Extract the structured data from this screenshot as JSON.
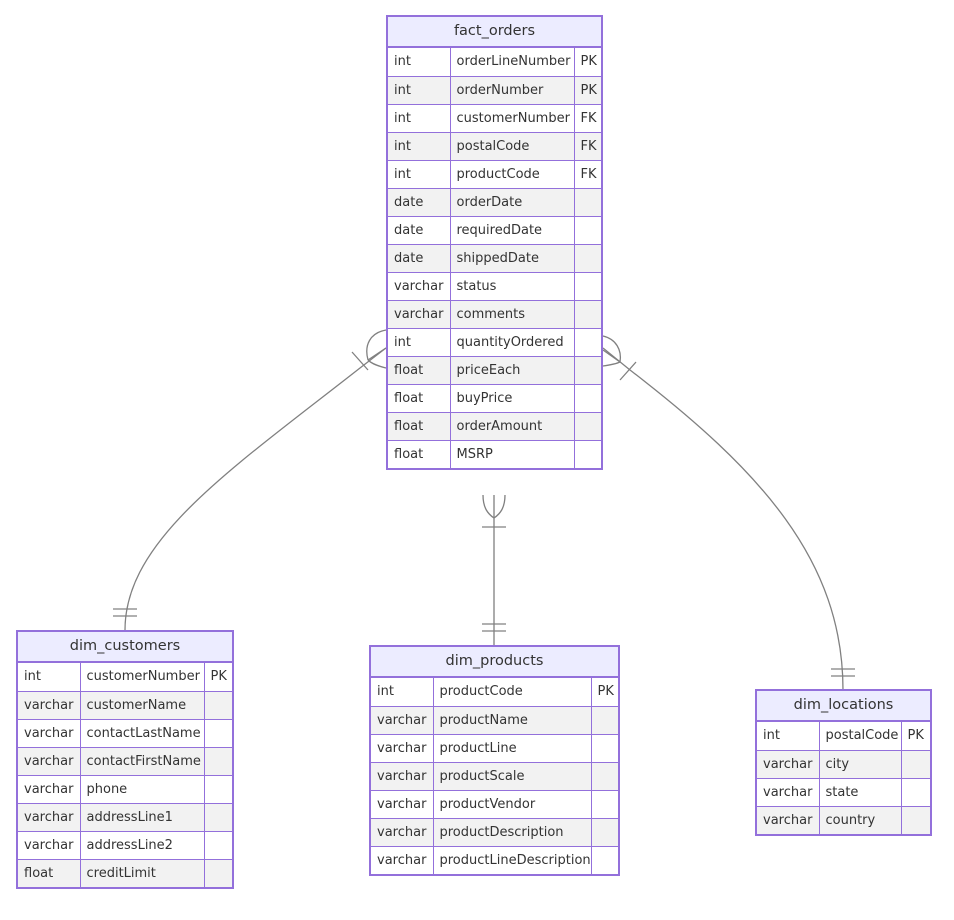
{
  "diagram": {
    "type": "entity-relationship",
    "colors": {
      "border": "#9370db",
      "header_bg": "#ececff",
      "row_alt": "#f2f2f2",
      "edge": "#808080"
    },
    "entities": [
      {
        "id": "fact_orders",
        "name": "fact_orders",
        "attributes": [
          {
            "type": "int",
            "name": "orderLineNumber",
            "key": "PK"
          },
          {
            "type": "int",
            "name": "orderNumber",
            "key": "PK"
          },
          {
            "type": "int",
            "name": "customerNumber",
            "key": "FK"
          },
          {
            "type": "int",
            "name": "postalCode",
            "key": "FK"
          },
          {
            "type": "int",
            "name": "productCode",
            "key": "FK"
          },
          {
            "type": "date",
            "name": "orderDate",
            "key": ""
          },
          {
            "type": "date",
            "name": "requiredDate",
            "key": ""
          },
          {
            "type": "date",
            "name": "shippedDate",
            "key": ""
          },
          {
            "type": "varchar",
            "name": "status",
            "key": ""
          },
          {
            "type": "varchar",
            "name": "comments",
            "key": ""
          },
          {
            "type": "int",
            "name": "quantityOrdered",
            "key": ""
          },
          {
            "type": "float",
            "name": "priceEach",
            "key": ""
          },
          {
            "type": "float",
            "name": "buyPrice",
            "key": ""
          },
          {
            "type": "float",
            "name": "orderAmount",
            "key": ""
          },
          {
            "type": "float",
            "name": "MSRP",
            "key": ""
          }
        ]
      },
      {
        "id": "dim_customers",
        "name": "dim_customers",
        "attributes": [
          {
            "type": "int",
            "name": "customerNumber",
            "key": "PK"
          },
          {
            "type": "varchar",
            "name": "customerName",
            "key": ""
          },
          {
            "type": "varchar",
            "name": "contactLastName",
            "key": ""
          },
          {
            "type": "varchar",
            "name": "contactFirstName",
            "key": ""
          },
          {
            "type": "varchar",
            "name": "phone",
            "key": ""
          },
          {
            "type": "varchar",
            "name": "addressLine1",
            "key": ""
          },
          {
            "type": "varchar",
            "name": "addressLine2",
            "key": ""
          },
          {
            "type": "float",
            "name": "creditLimit",
            "key": ""
          }
        ]
      },
      {
        "id": "dim_products",
        "name": "dim_products",
        "attributes": [
          {
            "type": "int",
            "name": "productCode",
            "key": "PK"
          },
          {
            "type": "varchar",
            "name": "productName",
            "key": ""
          },
          {
            "type": "varchar",
            "name": "productLine",
            "key": ""
          },
          {
            "type": "varchar",
            "name": "productScale",
            "key": ""
          },
          {
            "type": "varchar",
            "name": "productVendor",
            "key": ""
          },
          {
            "type": "varchar",
            "name": "productDescription",
            "key": ""
          },
          {
            "type": "varchar",
            "name": "productLineDescription",
            "key": ""
          }
        ]
      },
      {
        "id": "dim_locations",
        "name": "dim_locations",
        "attributes": [
          {
            "type": "int",
            "name": "postalCode",
            "key": "PK"
          },
          {
            "type": "varchar",
            "name": "city",
            "key": ""
          },
          {
            "type": "varchar",
            "name": "state",
            "key": ""
          },
          {
            "type": "varchar",
            "name": "country",
            "key": ""
          }
        ]
      }
    ],
    "relationships": [
      {
        "from": "fact_orders",
        "to": "dim_customers",
        "from_cardinality": "one-or-more",
        "to_cardinality": "exactly-one"
      },
      {
        "from": "fact_orders",
        "to": "dim_products",
        "from_cardinality": "one-or-more",
        "to_cardinality": "exactly-one"
      },
      {
        "from": "fact_orders",
        "to": "dim_locations",
        "from_cardinality": "one-or-more",
        "to_cardinality": "exactly-one"
      }
    ]
  }
}
